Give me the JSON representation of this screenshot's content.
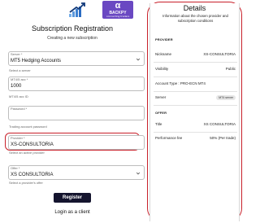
{
  "branding": {
    "partner_logo_glyph": "α",
    "partner_logo_word": "BACKPY",
    "partner_logo_subtext": "connecting traders"
  },
  "form": {
    "title": "Subscription Registration",
    "subtitle": "Creating a new subscription",
    "server": {
      "label": "Server *",
      "value": "MT5 Hedging Accounts",
      "helper": "Select a server"
    },
    "login": {
      "label": "MT4/5 acc *",
      "value": "1000",
      "helper": "MT4/5 acc ID"
    },
    "password": {
      "label": "Password *",
      "value": "",
      "helper": "Trading account password"
    },
    "provider": {
      "label": "Provider *",
      "value": "XS-CONSULTORIA",
      "helper": "Select an active provider"
    },
    "offer": {
      "label": "Offer *",
      "value": "XS CONSULTORIA",
      "helper": "Select a provider's offer"
    },
    "register_label": "Register",
    "login_link": "Login as a client"
  },
  "details": {
    "title": "Details",
    "description": "Information about the chosen provider and subscription conditions",
    "provider_section": "PROVIDER",
    "nickname_key": "Nickname",
    "nickname_value": "XS-CONSULTORIA",
    "visibility_key": "Visibility",
    "visibility_value": "Public",
    "account_type_key": "Account Type : PRO-ECN MT4",
    "server_key": "Server",
    "server_value": "MT4 server",
    "offer_section": "OFFER",
    "title_key": "Title",
    "title_value": "XS CONSULTORIA",
    "performance_fee_key": "Performance fee",
    "performance_fee_value": "50% (Per trade)"
  },
  "colors": {
    "highlight": "#c8202a",
    "primary_button": "#14142e",
    "partner_logo": "#6a48c2"
  },
  "icons": {
    "brand_logo": "blue-chart-arrow-logo",
    "dropdown": "chevron-down-icon"
  }
}
